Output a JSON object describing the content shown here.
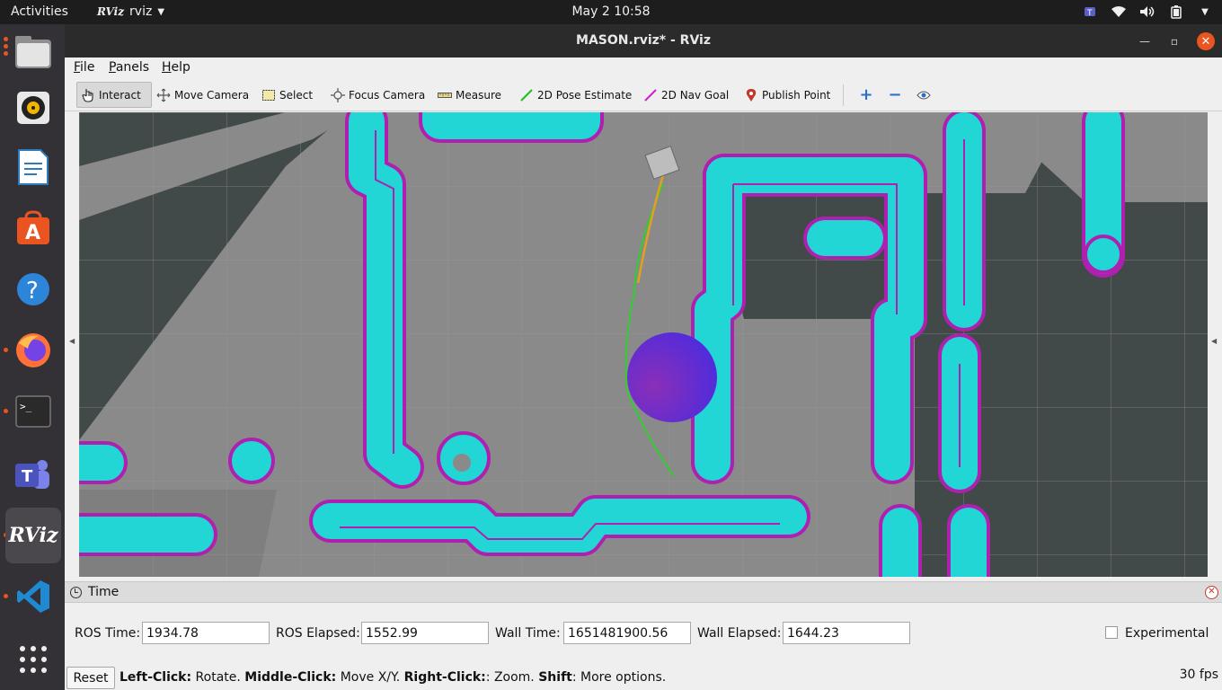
{
  "topbar": {
    "activities": "Activities",
    "app_logo": "RViz",
    "app_name": "rviz",
    "clock": "May 2  10:58",
    "tray_icons": [
      "teams-tray-icon",
      "wifi-icon",
      "volume-icon",
      "battery-icon",
      "power-menu-icon"
    ]
  },
  "dock": {
    "items": [
      {
        "name": "files-icon",
        "running": true
      },
      {
        "name": "rhythmbox-icon",
        "running": false
      },
      {
        "name": "libreoffice-writer-icon",
        "running": false
      },
      {
        "name": "software-center-icon",
        "running": false
      },
      {
        "name": "help-icon",
        "running": false
      },
      {
        "name": "firefox-icon",
        "running": true
      },
      {
        "name": "terminal-icon",
        "running": true
      },
      {
        "name": "teams-icon",
        "running": false
      },
      {
        "name": "rviz-icon",
        "running": true,
        "label": "RViz"
      },
      {
        "name": "vscode-icon",
        "running": true
      },
      {
        "name": "show-applications-icon",
        "running": false
      }
    ]
  },
  "window": {
    "title": "MASON.rviz* - RViz"
  },
  "menu": {
    "file": "File",
    "panels": "Panels",
    "help": "Help"
  },
  "toolbar": {
    "interact": "Interact",
    "move_camera": "Move Camera",
    "select": "Select",
    "focus_camera": "Focus Camera",
    "measure": "Measure",
    "pose_estimate": "2D Pose Estimate",
    "nav_goal": "2D Nav Goal",
    "publish_point": "Publish Point",
    "active_tool": "Interact"
  },
  "colors": {
    "costmap": "#22d6d6",
    "inflation_edge": "#b020b0",
    "free_space": "#8a8a8a",
    "unknown": "#424949",
    "global_plan": "#33cc33",
    "local_plan": "#e0a020",
    "goal_marker": "#7722cc"
  },
  "time_panel": {
    "title": "Time",
    "ros_time_label": "ROS Time:",
    "ros_time": "1934.78",
    "ros_elapsed_label": "ROS Elapsed:",
    "ros_elapsed": "1552.99",
    "wall_time_label": "Wall Time:",
    "wall_time": "1651481900.56",
    "wall_elapsed_label": "Wall Elapsed:",
    "wall_elapsed": "1644.23",
    "experimental": "Experimental"
  },
  "status": {
    "reset": "Reset",
    "left_click": "Left-Click:",
    "left_text": " Rotate. ",
    "middle_click": "Middle-Click:",
    "middle_text": " Move X/Y. ",
    "right_click": "Right-Click:",
    "right_text": ": Zoom. ",
    "shift": "Shift",
    "shift_text": ": More options.",
    "fps": "30 fps"
  }
}
